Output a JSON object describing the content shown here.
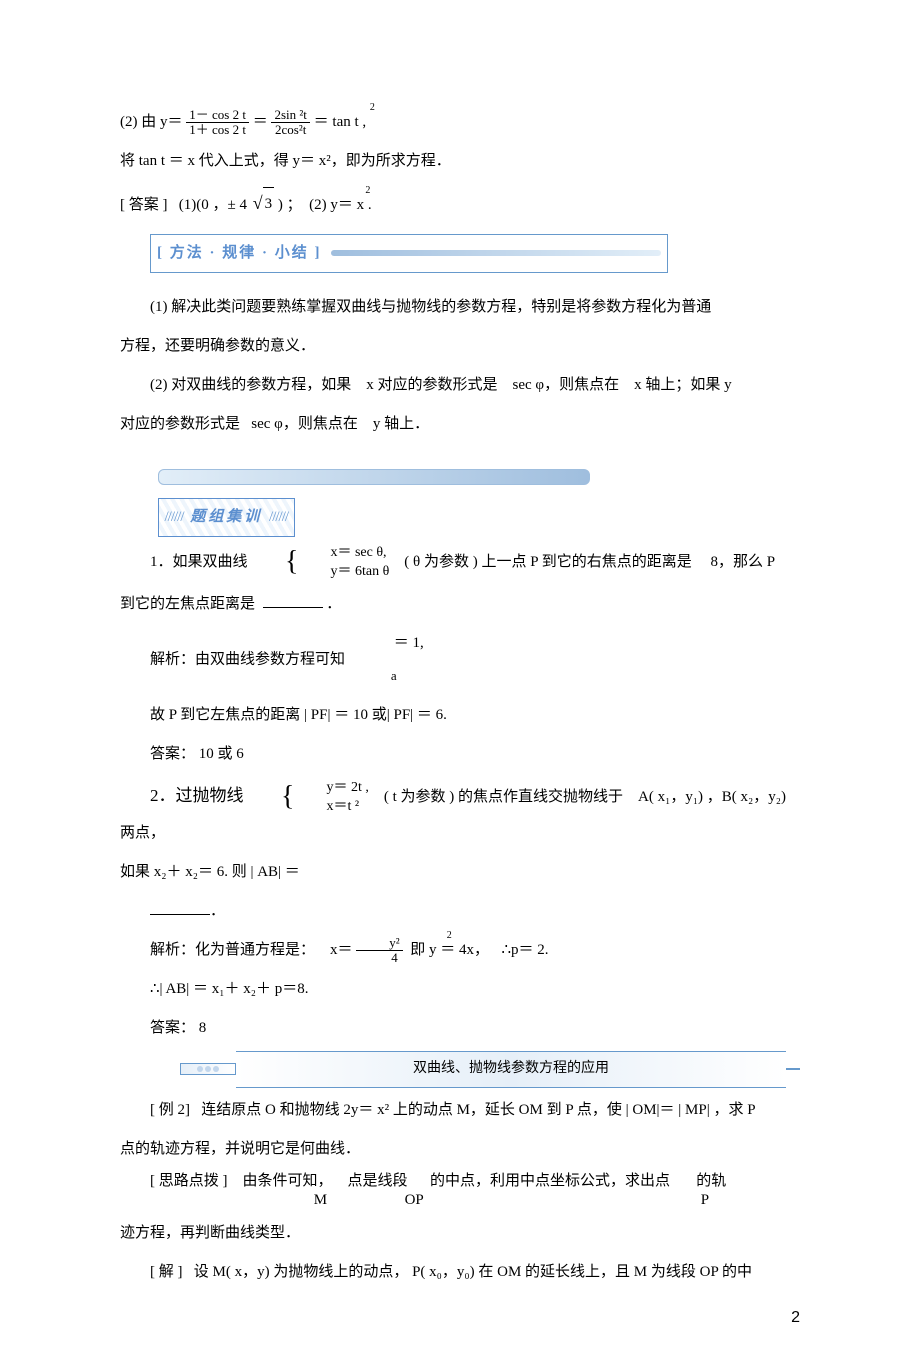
{
  "eq2_line1": {
    "prefix": "(2) 由 y＝",
    "num1": "1－ cos 2 t",
    "den1": "1＋ cos 2 t",
    "eq": "＝",
    "num2": "2sin ²t",
    "den2": "2cos²t",
    "suffix": "＝ tan t ,",
    "sup2": "2"
  },
  "eq2_line2": "将 tan  t ＝ x 代入上式，得  y＝ x²，即为所求方程．",
  "answer_line": {
    "label": "[ 答案 ]",
    "part1_a": "(1)(0 ，± 4 ",
    "part1_rad": "3",
    "part1_b": ") ；",
    "part2_a": "(2) y＝ x .",
    "part2_sup": "2"
  },
  "method_box": "[ 方法 · 规律 · 小结 ]",
  "note1": "(1) 解决此类问题要熟练掌握双曲线与抛物线的参数方程，特别是将参数方程化为普通",
  "note1b": "方程，还要明确参数的意义．",
  "note2a": "(2) 对双曲线的参数方程，如果",
  "note2b": "x 对应的参数形式是",
  "note2c": "sec φ，则焦点在",
  "note2d": "x 轴上；如果  y",
  "note3a": "对应的参数形式是",
  "note3b": "sec φ，则焦点在",
  "note3c": "y 轴上．",
  "tzjl_label": "题组集训",
  "tzjl_hatch": "//////",
  "q1": {
    "prefix": "1．如果双曲线",
    "item1": "x＝ sec  θ,",
    "item2": "y＝ 6tan  θ",
    "mid_a": "( θ 为参数 ) 上一点  P 到它的右焦点的距离是",
    "mid_b": "8，那么  P",
    "line2a": "到它的左焦点距离是",
    "dot": "．",
    "sol_a": "解析：由双曲线参数方程可知",
    "sol_eq": "＝ 1,",
    "sol_var": "a",
    "sol_b": "故 P 到它左焦点的距离   | PF| ＝ 10 或| PF| ＝ 6.",
    "ans": "答案： 10 或 6"
  },
  "q2": {
    "prefix": "2．过抛物线",
    "item1": "y＝ 2t ,",
    "item2": "x＝t ²",
    "mid_a": "( t 为参数 ) 的焦点作直线交抛物线于",
    "mid_b": "A( x₁，y₁) ，B( x₂，y₂) 两点，",
    "line2a": "如果 x₂＋ x₂＝ 6. 则 | AB| ＝",
    "dot": "．",
    "sol_a": "解析：化为普通方程是：",
    "frac_pre": "x＝",
    "frac_num": "y²",
    "frac_den": "4",
    "sol_b_a": "即 y ＝ 4x，",
    "sol_b_sup": "2",
    "sol_b_b": "∴p＝ 2.",
    "sol_c": "∴| AB| ＝ x₁＋ x₂＋ p＝8.",
    "ans": "答案： 8"
  },
  "ex2": {
    "banner": "双曲线、抛物线参数方程的应用",
    "label": "[ 例 2]",
    "l1a": "连结原点  O 和抛物线  2y＝ x² 上的动点  M，延长  OM 到 P 点，使 | OM|＝ | MP| ，求 P",
    "l1b": "点的轨迹方程，并说明它是何曲线．",
    "hint_label": "[ 思路点拨 ]",
    "hint_a": "由条件可知，",
    "hint_b": "点是线段",
    "hint_c": "的中点，利用中点坐标公式，求出点",
    "hint_d": "的轨",
    "hint_M": "M",
    "hint_OP": "OP",
    "hint_P": "P",
    "hint_tail": "迹方程，再判断曲线类型．",
    "sol_label": "[ 解 ]",
    "sol_a": "设 M( x，y) 为抛物线上的动点， P( x₀，y₀) 在 OM 的延长线上，且  M 为线段  OP 的中"
  },
  "page_num": "2"
}
